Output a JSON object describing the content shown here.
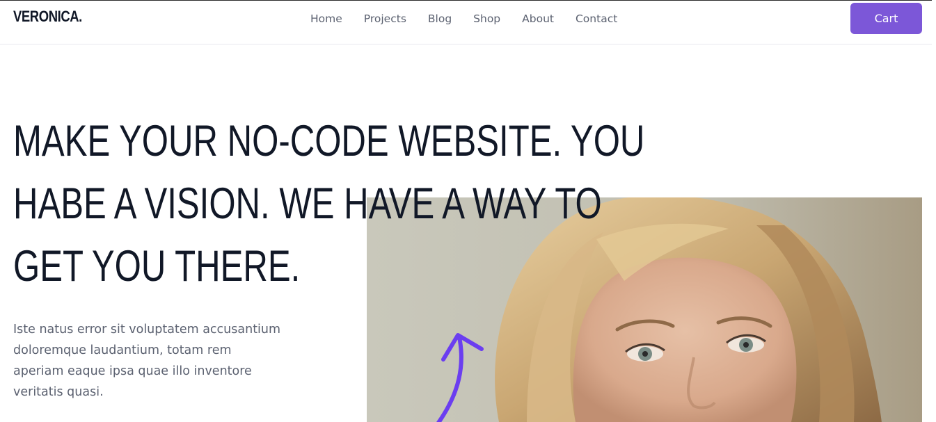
{
  "header": {
    "logo": "VERONICA.",
    "nav": [
      {
        "label": "Home"
      },
      {
        "label": "Projects"
      },
      {
        "label": "Blog"
      },
      {
        "label": "Shop"
      },
      {
        "label": "About"
      },
      {
        "label": "Contact"
      }
    ],
    "cart_label": "Cart"
  },
  "hero": {
    "title_lines": [
      "MAKE YOUR NO-CODE WEBSITE. YOU",
      "HABE A VISION. WE HAVE A WAY TO",
      "GET YOU THERE."
    ],
    "description": "Iste natus error sit voluptatem accusantium doloremque laudantium, totam rem aperiam eaque ipsa quae illo inventore veritatis quasi."
  },
  "colors": {
    "accent": "#7c57d8",
    "heading": "#111827",
    "body_text": "#5b6170"
  },
  "icons": [
    "curved-arrow-icon"
  ]
}
